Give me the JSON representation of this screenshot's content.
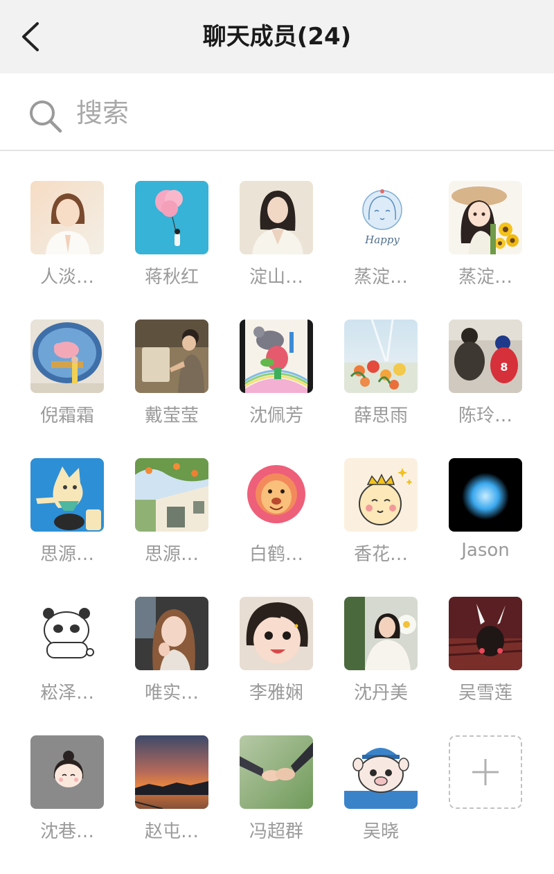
{
  "header": {
    "title": "聊天成员(24)",
    "back_icon": "chevron-left-icon"
  },
  "search": {
    "placeholder": "搜索",
    "value": "",
    "icon": "search-icon"
  },
  "members": [
    {
      "name": "人淡…"
    },
    {
      "name": "蒋秋红"
    },
    {
      "name": "淀山…"
    },
    {
      "name": "蒸淀…",
      "avatar_text": "Happy"
    },
    {
      "name": "蒸淀…"
    },
    {
      "name": "倪霜霜"
    },
    {
      "name": "戴莹莹"
    },
    {
      "name": "沈佩芳"
    },
    {
      "name": "薛思雨"
    },
    {
      "name": "陈玲…"
    },
    {
      "name": "思源…"
    },
    {
      "name": "思源…"
    },
    {
      "name": "白鹤…"
    },
    {
      "name": "香花…"
    },
    {
      "name": "Jason"
    },
    {
      "name": "崧泽…"
    },
    {
      "name": "唯实…"
    },
    {
      "name": "李雅娴"
    },
    {
      "name": "沈丹美"
    },
    {
      "name": "吴雪莲"
    },
    {
      "name": "沈巷…"
    },
    {
      "name": "赵屯…"
    },
    {
      "name": "冯超群"
    },
    {
      "name": "吴晓"
    }
  ],
  "add_member": {
    "icon": "plus-icon"
  }
}
